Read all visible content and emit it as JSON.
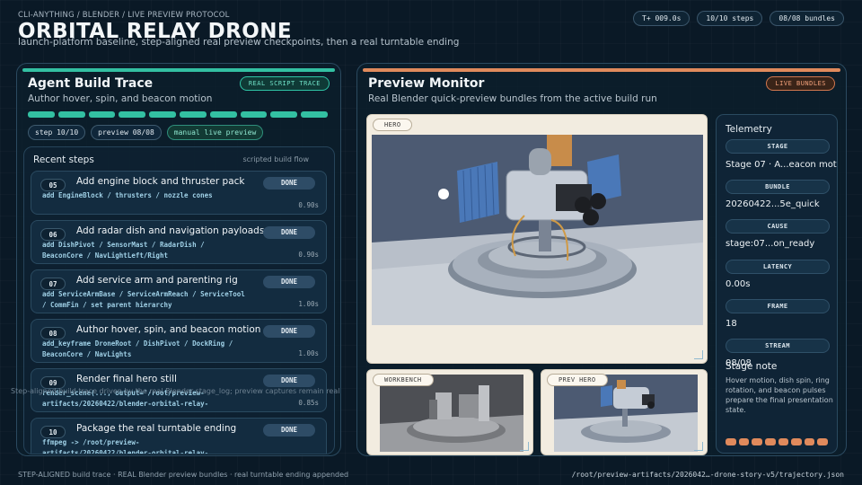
{
  "header": {
    "kicker": "CLI-ANYTHING / BLENDER / LIVE PREVIEW PROTOCOL",
    "title": "ORBITAL RELAY DRONE",
    "subtitle": "launch-platform baseline, step-aligned real preview checkpoints, then a real turntable ending",
    "pills": [
      "T+ 009.0s",
      "10/10 steps",
      "08/08 bundles"
    ]
  },
  "left_panel": {
    "title": "Agent Build Trace",
    "subtitle": "Author hover, spin, and beacon motion",
    "badge": "REAL SCRIPT TRACE",
    "segments_total": 10,
    "segments_done": 10,
    "chips": [
      "step 10/10",
      "preview 08/08",
      "manual live preview"
    ],
    "steps_title": "Recent steps",
    "steps_tag": "scripted build flow",
    "steps": [
      {
        "num": "05",
        "title": "Add engine block and thruster pack",
        "code": "add EngineBlock / thrusters / nozzle cones",
        "time": "0.90s",
        "status": "DONE"
      },
      {
        "num": "06",
        "title": "Add radar dish and navigation payloads",
        "code": "add DishPivot / SensorMast / RadarDish / BeaconCore / NavLightLeft/Right",
        "time": "0.90s",
        "status": "DONE"
      },
      {
        "num": "07",
        "title": "Add service arm and parenting rig",
        "code": "add ServiceArmBase / ServiceArmReach / ServiceTool / CommFin / set parent hierarchy",
        "time": "1.00s",
        "status": "DONE"
      },
      {
        "num": "08",
        "title": "Author hover, spin, and beacon motion",
        "code": "add_keyframe DroneRoot / DishPivot / DockRing / BeaconCore / NavLights",
        "time": "1.00s",
        "status": "DONE"
      },
      {
        "num": "09",
        "title": "Render final hero still",
        "code": "render_scene(..., output='/root/preview-artifacts/20260422/blender-orbital-relay-",
        "time": "0.85s",
        "status": "DONE"
      },
      {
        "num": "10",
        "title": "Package the real turntable ending",
        "code": "ffmpeg -> /root/preview-artifacts/20260422/blender-orbital-relay-",
        "time": "",
        "status": "DONE"
      }
    ],
    "ticker": "Step-aligned build trace driven by the real Blender stage_log; preview captures remain real artifacts"
  },
  "right_panel": {
    "title": "Preview Monitor",
    "subtitle": "Real Blender quick-preview bundles from the active build run",
    "badge": "LIVE BUNDLES",
    "frames": {
      "hero": "HERO",
      "workbench": "WORKBENCH",
      "prev_hero": "PREV HERO"
    },
    "telemetry": {
      "title": "Telemetry",
      "items": [
        {
          "label": "STAGE",
          "value": "Stage 07 · A...eacon motion"
        },
        {
          "label": "BUNDLE",
          "value": "20260422...5e_quick"
        },
        {
          "label": "CAUSE",
          "value": "stage:07...on_ready"
        },
        {
          "label": "LATENCY",
          "value": "0.00s"
        },
        {
          "label": "FRAME",
          "value": "18"
        },
        {
          "label": "STREAM",
          "value": "08/08"
        }
      ],
      "note_title": "Stage note",
      "note": "Hover motion, dish spin, ring rotation, and beacon pulses prepare the final presentation state.",
      "note_segments": 8
    }
  },
  "footer": {
    "left": "STEP-ALIGNED build trace · REAL Blender preview bundles · real turntable ending appended",
    "right": "/root/preview-artifacts/2026042…-drone-story-v5/trajectory.json"
  },
  "colors": {
    "accent_green": "#33c0a2",
    "accent_orange": "#e08a5c",
    "background": "#0a1926"
  }
}
